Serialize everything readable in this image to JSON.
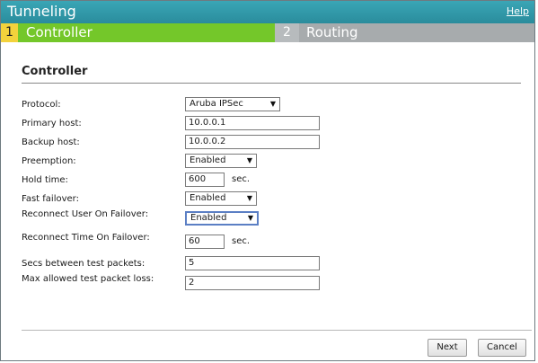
{
  "window": {
    "title": "Tunneling",
    "help_label": "Help"
  },
  "steps": [
    {
      "number": "1",
      "label": "Controller",
      "active": true
    },
    {
      "number": "2",
      "label": "Routing",
      "active": false
    }
  ],
  "section": {
    "title": "Controller"
  },
  "form": {
    "protocol": {
      "label": "Protocol:",
      "value": "Aruba IPSec"
    },
    "primary_host": {
      "label": "Primary host:",
      "value": "10.0.0.1"
    },
    "backup_host": {
      "label": "Backup host:",
      "value": "10.0.0.2"
    },
    "preemption": {
      "label": "Preemption:",
      "value": "Enabled"
    },
    "hold_time": {
      "label": "Hold time:",
      "value": "600",
      "unit": "sec."
    },
    "fast_failover": {
      "label": "Fast failover:",
      "value": "Enabled"
    },
    "reconnect_user": {
      "label": "Reconnect User On Failover:",
      "value": "Enabled"
    },
    "reconnect_time": {
      "label": "Reconnect Time On Failover:",
      "value": "60",
      "unit": "sec."
    },
    "secs_between": {
      "label": "Secs between test packets:",
      "value": "5"
    },
    "max_loss": {
      "label": "Max allowed test packet loss:",
      "value": "2"
    }
  },
  "buttons": {
    "next": "Next",
    "cancel": "Cancel"
  },
  "colors": {
    "titlebar": "#2f95a5",
    "active_step": "#74c72a",
    "step_number_active": "#f3d23c",
    "inactive_step": "#a7abad"
  },
  "icons": {
    "dropdown": "triangle-down-icon"
  }
}
